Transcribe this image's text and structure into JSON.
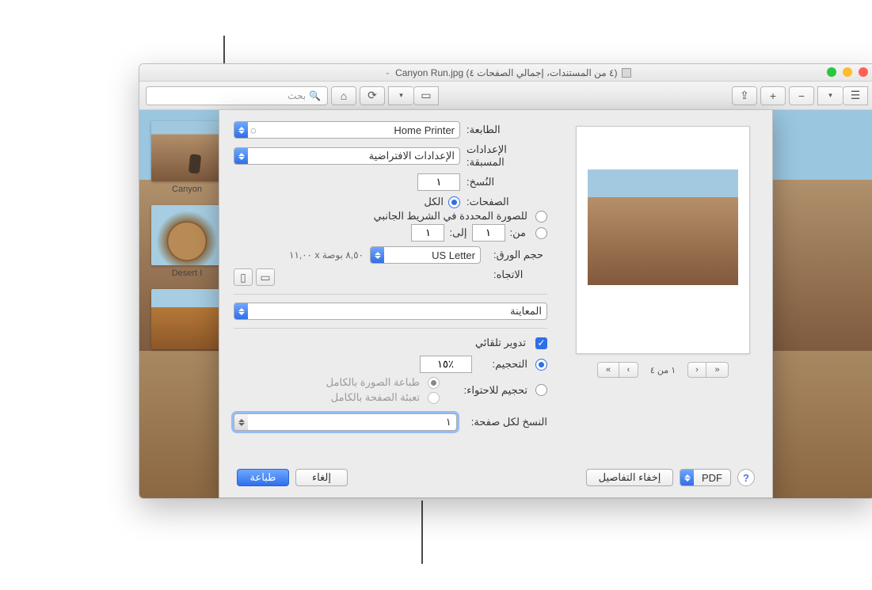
{
  "titlebar": {
    "title": "Canyon Run.jpg (٤ من المستندات، إجمالي الصفحات ٤)"
  },
  "toolbar": {
    "search_placeholder": "بحث"
  },
  "sidebar": {
    "thumbs": [
      {
        "label": "Canyon"
      },
      {
        "label": "Desert I"
      },
      {
        "label": ""
      }
    ]
  },
  "print": {
    "labels": {
      "printer": "الطابعة:",
      "presets": "الإعدادات المسبقة:",
      "copies": "النُسخ:",
      "pages": "الصفحات:",
      "paper": "حجم الورق:",
      "orientation": "الاتجاه:",
      "all": "الكل",
      "selected": "للصورة المحددة في الشريط الجانبي",
      "from": "من:",
      "to": "إلى:",
      "auto_rotate": "تدوير تلقائي",
      "scale": "التحجيم:",
      "scale_fit": "تحجيم للاحتواء:",
      "print_whole_image": "طباعة الصورة بالكامل",
      "fill_whole_page": "تعبئة الصفحة بالكامل",
      "copies_per_page": "النسخ لكل صفحة:",
      "section": "المعاينة"
    },
    "values": {
      "printer": "Home Printer",
      "presets": "الإعدادات الافتراضية",
      "copies": "١",
      "from": "١",
      "to": "١",
      "paper": "US Letter",
      "paper_dim": "٨,٥٠ بوصة x ‏١١,٠٠",
      "scale_pct": "١٥٪",
      "copies_per_page": "١"
    },
    "pager": {
      "label": "١ من ٤"
    },
    "buttons": {
      "help": "?",
      "pdf": "PDF",
      "hide_details": "إخفاء التفاصيل",
      "cancel": "إلغاء",
      "print": "طباعة"
    }
  }
}
